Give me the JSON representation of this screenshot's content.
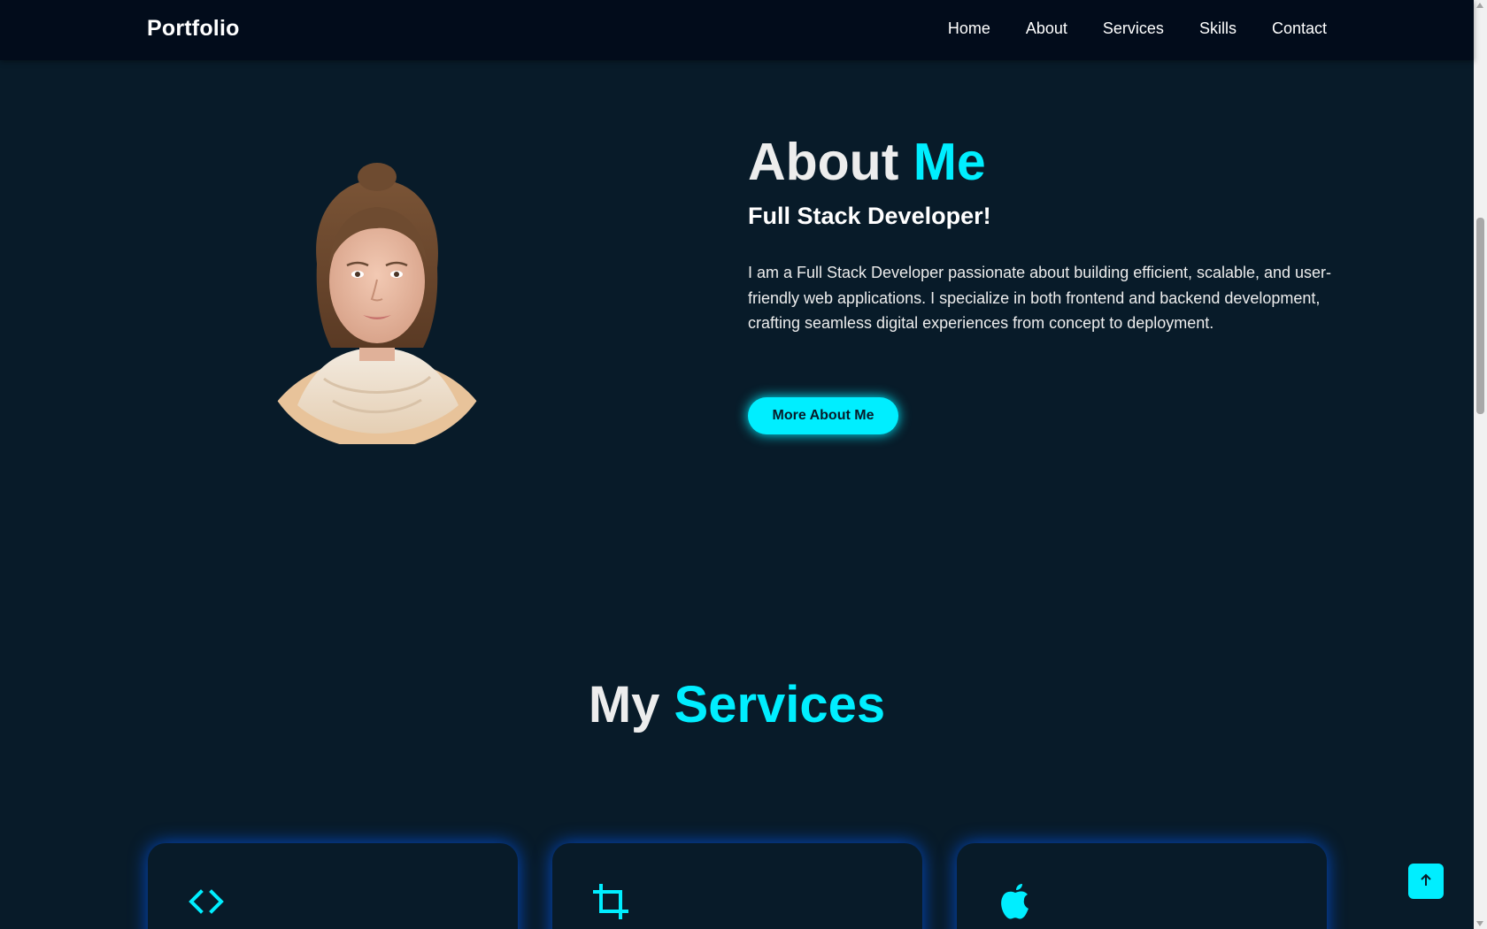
{
  "header": {
    "logo": "Portfolio",
    "nav": [
      "Home",
      "About",
      "Services",
      "Skills",
      "Contact"
    ]
  },
  "about": {
    "title_part1": "About ",
    "title_part2": "Me",
    "subtitle": "Full Stack Developer!",
    "text": "I am a Full Stack Developer passionate about building efficient, scalable, and user-friendly web applications. I specialize in both frontend and backend development, crafting seamless digital experiences from concept to deployment.",
    "button_label": "More About Me"
  },
  "services": {
    "title_part1": "My ",
    "title_part2": "Services",
    "cards": [
      {
        "icon": "code-icon"
      },
      {
        "icon": "crop-icon"
      },
      {
        "icon": "apple-icon"
      }
    ]
  },
  "colors": {
    "background": "#081b29",
    "header_bg": "#020c1b",
    "accent": "#00eeff",
    "card_glow": "#005cff"
  }
}
